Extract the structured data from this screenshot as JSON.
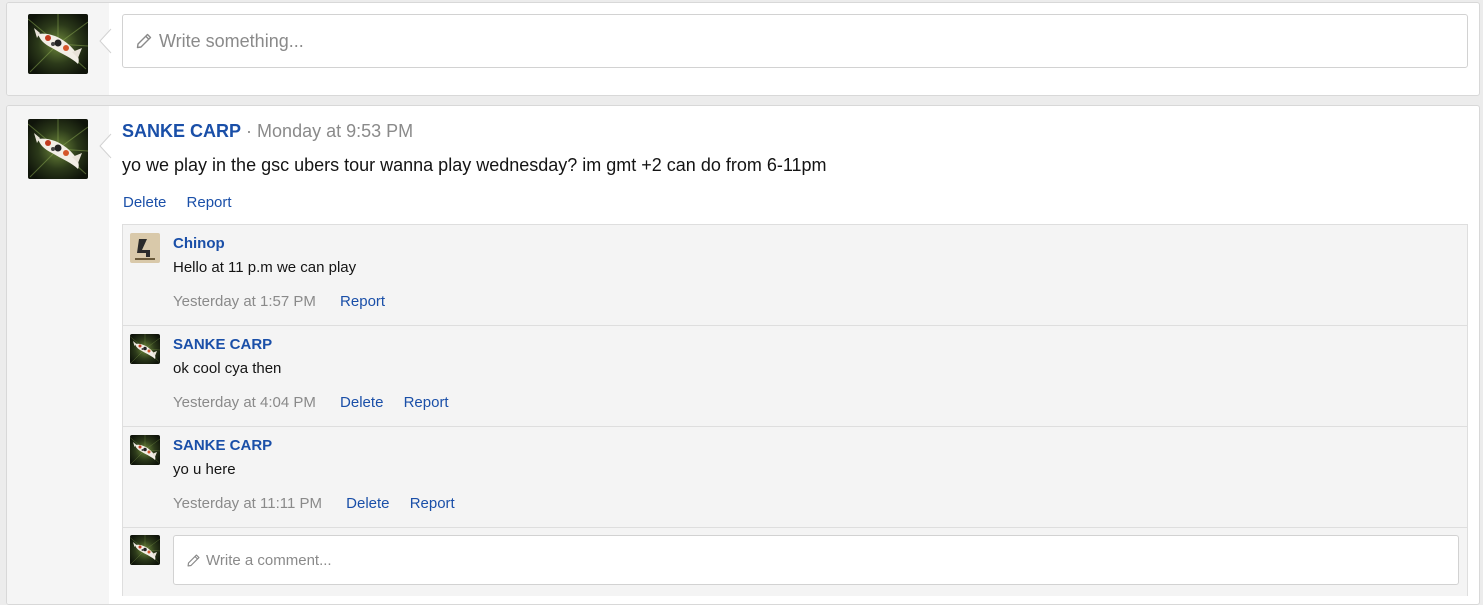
{
  "composer": {
    "placeholder": "Write something..."
  },
  "post": {
    "author": "SANKE CARP",
    "separator": "·",
    "timestamp": "Monday at 9:53 PM",
    "text": "yo we play in the gsc ubers tour wanna play wednesday? im gmt +2 can do from 6-11pm",
    "actions": {
      "delete": "Delete",
      "report": "Report"
    },
    "comments": [
      {
        "author": "Chinop",
        "text": "Hello at 11 p.m we can play",
        "timestamp": "Yesterday at 1:57 PM",
        "report": "Report"
      },
      {
        "author": "SANKE CARP",
        "text": "ok cool cya then",
        "timestamp": "Yesterday at 4:04 PM",
        "delete": "Delete",
        "report": "Report"
      },
      {
        "author": "SANKE CARP",
        "text": "yo u here",
        "timestamp": "Yesterday at 11:11 PM",
        "delete": "Delete",
        "report": "Report"
      }
    ],
    "comment_placeholder": "Write a comment..."
  },
  "colors": {
    "link": "#1a4fa8",
    "muted": "#8a8a8a",
    "panel": "#f4f4f4"
  },
  "icons": {
    "composer": "pencil-icon",
    "comment_box": "pencil-icon",
    "avatar_user": "koi-fish-avatar",
    "avatar_chinop": "chinop-avatar"
  }
}
